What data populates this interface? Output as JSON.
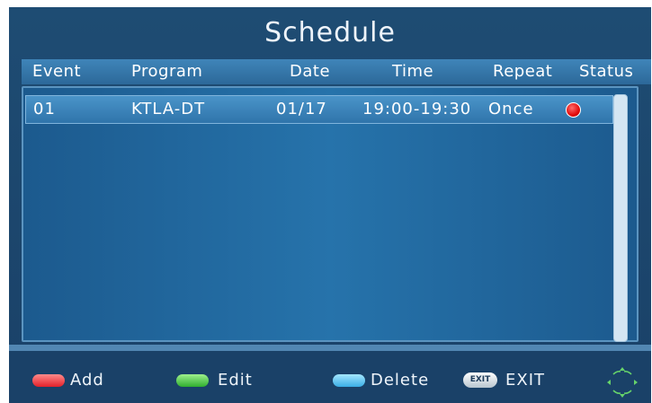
{
  "title": "Schedule",
  "columns": [
    "Event",
    "Program",
    "Date",
    "Time",
    "Repeat",
    "Status"
  ],
  "rows": [
    {
      "event": "01",
      "program": "KTLA-DT",
      "date": "01/17",
      "time": "19:00-19:30",
      "repeat": "Once",
      "status": "recording-dot"
    }
  ],
  "footer": {
    "add_label": "Add",
    "edit_label": "Edit",
    "delete_label": "Delete",
    "exit_key": "EXIT",
    "exit_label": "EXIT"
  },
  "colors": {
    "red_key": "#e2202a",
    "green_key": "#2fae2f",
    "blue_key": "#3aaee6",
    "status_dot": "#e30c0c"
  }
}
